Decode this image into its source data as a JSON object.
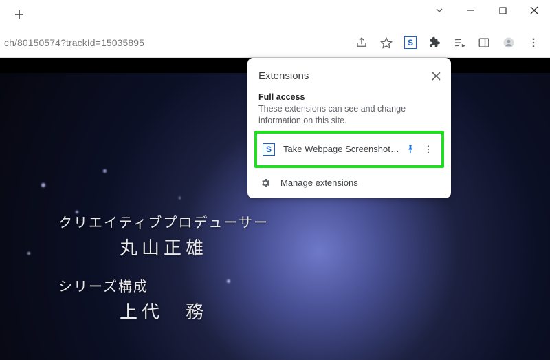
{
  "window": {
    "minimize_tip": "Minimize",
    "maximize_tip": "Maximize",
    "close_tip": "Close",
    "tabs_chevron_tip": "Search tabs"
  },
  "tabs": {
    "newtab_tip": "New Tab"
  },
  "toolbar": {
    "url_fragment": "ch/80150574?trackId=15035895",
    "share_tip": "Share this page",
    "star_tip": "Bookmark this tab",
    "s_ext_tip": "Take Webpage Screenshots",
    "extensions_tip": "Extensions",
    "media_tip": "Control your music, videos and more",
    "sidepanel_tip": "Side panel",
    "profile_tip": "You",
    "menu_tip": "Customize and control Google Chrome"
  },
  "ext_popup": {
    "title": "Extensions",
    "close_tip": "Close",
    "section_label": "Full access",
    "section_desc": "These extensions can see and change information on this site.",
    "item_name": "Take Webpage Screenshots Enti…",
    "pin_tip": "Pin",
    "more_tip": "More options",
    "manage_label": "Manage extensions"
  },
  "video_credits": {
    "role1": "クリエイティブプロデューサー",
    "name1": "丸山正雄",
    "role2": "シリーズ構成",
    "name2": "上代　務"
  }
}
